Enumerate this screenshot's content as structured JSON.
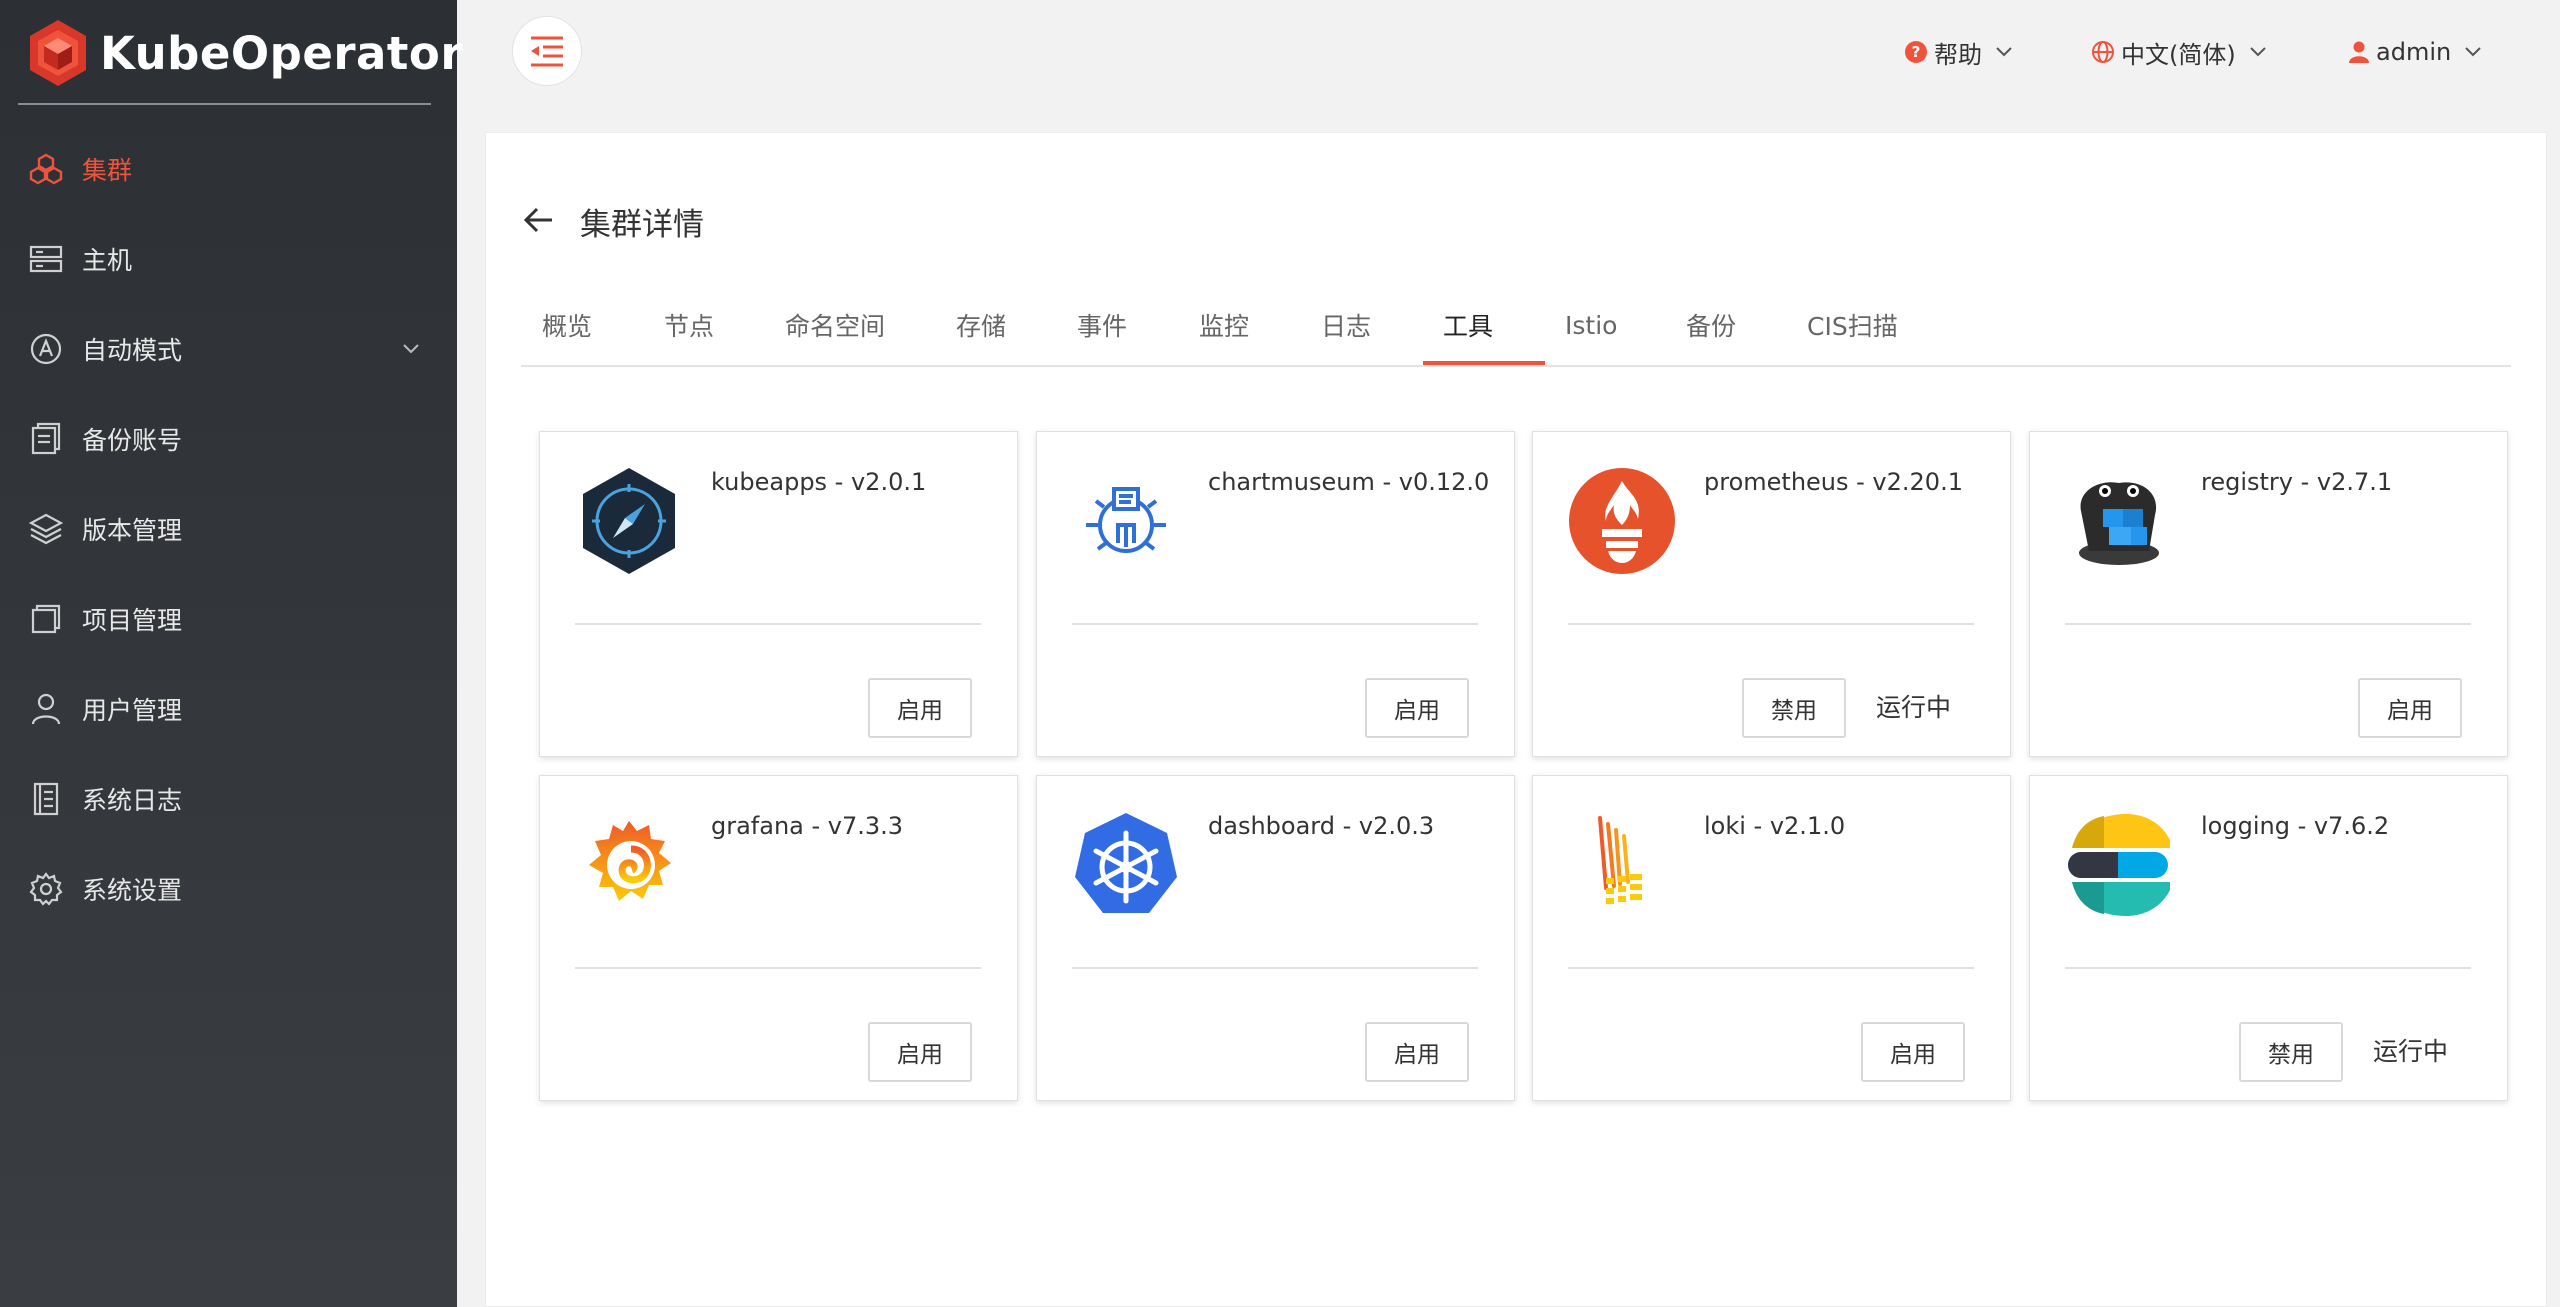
{
  "app": {
    "name": "KubeOperator"
  },
  "sidebar": {
    "items": [
      {
        "label": "集群",
        "icon": "cluster-icon",
        "active": true
      },
      {
        "label": "主机",
        "icon": "server-icon"
      },
      {
        "label": "自动模式",
        "icon": "auto-mode-icon",
        "expandable": true
      },
      {
        "label": "备份账号",
        "icon": "backup-account-icon"
      },
      {
        "label": "版本管理",
        "icon": "layers-icon"
      },
      {
        "label": "项目管理",
        "icon": "project-icon"
      },
      {
        "label": "用户管理",
        "icon": "user-icon"
      },
      {
        "label": "系统日志",
        "icon": "log-icon"
      },
      {
        "label": "系统设置",
        "icon": "gear-icon"
      }
    ]
  },
  "header": {
    "help_label": "帮助",
    "language_label": "中文(简体)",
    "user_label": "admin"
  },
  "page": {
    "title": "集群详情",
    "tabs": [
      "概览",
      "节点",
      "命名空间",
      "存储",
      "事件",
      "监控",
      "日志",
      "工具",
      "Istio",
      "备份",
      "CIS扫描"
    ],
    "active_tab": "工具"
  },
  "tools": [
    {
      "name": "kubeapps - v2.0.1",
      "button": "启用",
      "status": ""
    },
    {
      "name": "chartmuseum - v0.12.0",
      "button": "启用",
      "status": ""
    },
    {
      "name": "prometheus - v2.20.1",
      "button": "禁用",
      "status": "运行中"
    },
    {
      "name": "registry - v2.7.1",
      "button": "启用",
      "status": ""
    },
    {
      "name": "grafana - v7.3.3",
      "button": "启用",
      "status": ""
    },
    {
      "name": "dashboard - v2.0.3",
      "button": "启用",
      "status": ""
    },
    {
      "name": "loki - v2.1.0",
      "button": "启用",
      "status": ""
    },
    {
      "name": "logging - v7.6.2",
      "button": "禁用",
      "status": "运行中"
    }
  ],
  "colors": {
    "accent": "#f0533b",
    "sidebar_bg": "#2f3337"
  }
}
